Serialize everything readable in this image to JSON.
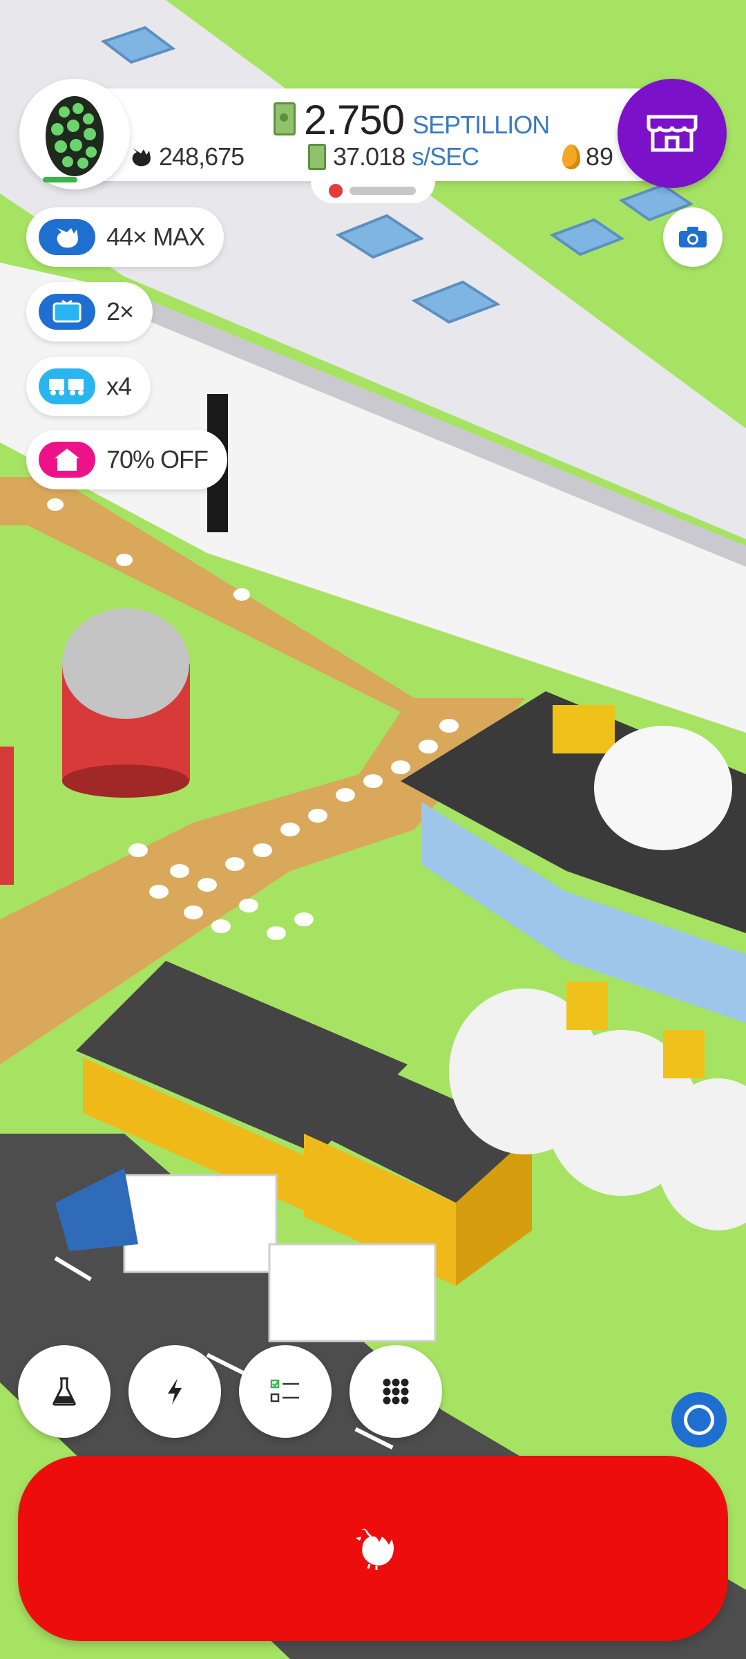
{
  "hud": {
    "money_value": "2.750",
    "money_unit": "SEPTILLION",
    "chicken_count": "248,675",
    "earn_rate_value": "37.018",
    "earn_rate_unit": "s/SEC",
    "golden_eggs": "89"
  },
  "boosts": [
    {
      "icon": "chicken-icon",
      "label": "44× MAX",
      "color": "#1f6fd1"
    },
    {
      "icon": "tv-icon",
      "label": "2×",
      "color": "#1f6fd1"
    },
    {
      "icon": "trucks-icon",
      "label": "x4",
      "color": "#29b6f0"
    },
    {
      "icon": "home-icon",
      "label": "70% OFF",
      "color": "#ee1289"
    }
  ],
  "bottom_bar": {
    "buttons": [
      "research-flask-icon",
      "boost-lightning-icon",
      "missions-checklist-icon",
      "menu-grid-icon"
    ],
    "hatch_icon": "chicken-icon",
    "hatch_color": "#ee0d0d"
  },
  "colors": {
    "grass": "#a6e363",
    "road": "#555555",
    "path": "#d9a85a",
    "shop": "#7b12c9"
  }
}
